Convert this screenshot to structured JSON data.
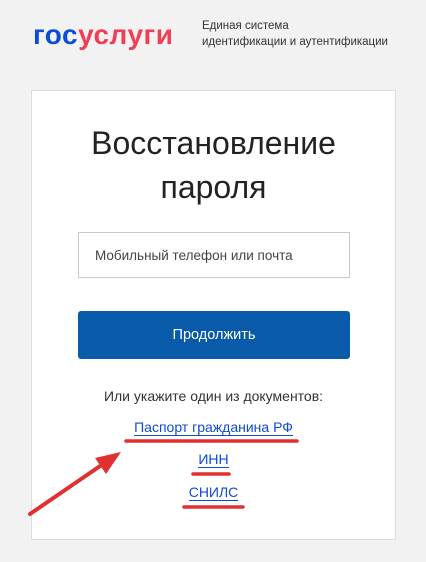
{
  "logo": {
    "part1": "гос",
    "part2": "услуги",
    "subtitle_line1": "Единая система",
    "subtitle_line2": "идентификации и аутентификации"
  },
  "form": {
    "title_line1": "Восстановление",
    "title_line2": "пароля",
    "input_placeholder": "Мобильный телефон или почта",
    "input_value": "",
    "continue_label": "Продолжить"
  },
  "documents": {
    "label": "Или укажите один из документов:",
    "links": [
      {
        "label": "Паспорт гражданина РФ"
      },
      {
        "label": "ИНН"
      },
      {
        "label": "СНИЛС"
      }
    ]
  },
  "colors": {
    "brand_blue": "#0d4cd3",
    "brand_red": "#ee3f58",
    "button_blue": "#0a5aaa",
    "annotation_red": "#e03030"
  }
}
